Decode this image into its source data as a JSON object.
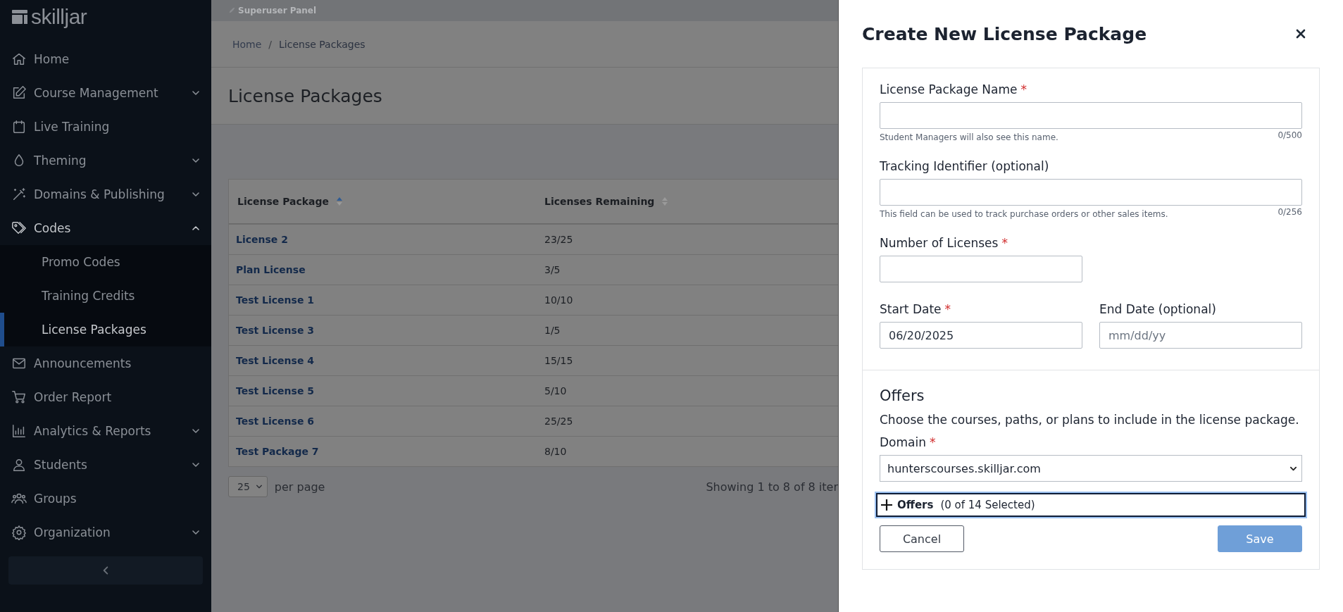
{
  "sidebar": {
    "logo": "skilljar",
    "items": [
      {
        "label": "Home",
        "expandable": false,
        "expanded": false
      },
      {
        "label": "Course Management",
        "expandable": true,
        "expanded": false
      },
      {
        "label": "Live Training",
        "expandable": false,
        "expanded": false
      },
      {
        "label": "Theming",
        "expandable": true,
        "expanded": false
      },
      {
        "label": "Domains & Publishing",
        "expandable": true,
        "expanded": false
      },
      {
        "label": "Codes",
        "expandable": true,
        "expanded": true,
        "children": [
          {
            "label": "Promo Codes",
            "selected": false
          },
          {
            "label": "Training Credits",
            "selected": false
          },
          {
            "label": "License Packages",
            "selected": true
          }
        ]
      },
      {
        "label": "Announcements",
        "expandable": false,
        "expanded": false
      },
      {
        "label": "Order Report",
        "expandable": false,
        "expanded": false
      },
      {
        "label": "Analytics & Reports",
        "expandable": true,
        "expanded": false
      },
      {
        "label": "Students",
        "expandable": true,
        "expanded": false
      },
      {
        "label": "Groups",
        "expandable": false,
        "expanded": false
      },
      {
        "label": "Organization",
        "expandable": true,
        "expanded": false
      }
    ]
  },
  "superuser_bar": "Superuser Panel",
  "breadcrumb": [
    "Home",
    "License Packages"
  ],
  "breadcrumb_separator": "/",
  "required_marker": "*",
  "page_title": "License Packages",
  "table": {
    "columns": [
      {
        "label": "License Package",
        "sorted": true
      },
      {
        "label": "Licenses Remaining",
        "sorted": false
      }
    ],
    "rows": [
      [
        "License 2",
        "23/25"
      ],
      [
        "Plan License",
        "3/5"
      ],
      [
        "Test License 1",
        "10/10"
      ],
      [
        "Test License 3",
        "1/5"
      ],
      [
        "Test License 4",
        "15/15"
      ],
      [
        "Test License 5",
        "5/10"
      ],
      [
        "Test License 6",
        "25/25"
      ],
      [
        "Test Package 7",
        "8/10"
      ]
    ]
  },
  "pagination": {
    "per_page": "25",
    "per_page_label": "per page",
    "summary": "Showing 1 to 8 of 8 iter"
  },
  "drawer": {
    "title": "Create New License Package",
    "fields": [
      {
        "kind": "text",
        "label": "License Package Name",
        "required": true,
        "hint": "Student Managers will also see this name.",
        "counter": "0/500"
      },
      {
        "kind": "text",
        "label": "Tracking Identifier (optional)",
        "required": false,
        "hint": "This field can be used to track purchase orders or other sales items.",
        "counter": "0/256"
      },
      {
        "kind": "number",
        "label": "Number of Licenses",
        "required": true
      }
    ],
    "dates": [
      {
        "label": "Start Date",
        "required": true,
        "value": "06/20/2025"
      },
      {
        "label": "End Date (optional)",
        "required": false,
        "placeholder": "mm/dd/yy"
      }
    ],
    "offers": {
      "heading": "Offers",
      "description": "Choose the courses, paths, or plans to include in the license package.",
      "domain_label": "Domain",
      "domain_required": true,
      "domain_value": "hunterscourses.skilljar.com",
      "toggle_label": "Offers",
      "toggle_count": "(0 of 14 Selected)",
      "toggle_focused": true
    },
    "buttons": [
      {
        "label": "Cancel",
        "kind": "secondary",
        "disabled": false
      },
      {
        "label": "Save",
        "kind": "primary",
        "disabled": true
      }
    ]
  }
}
